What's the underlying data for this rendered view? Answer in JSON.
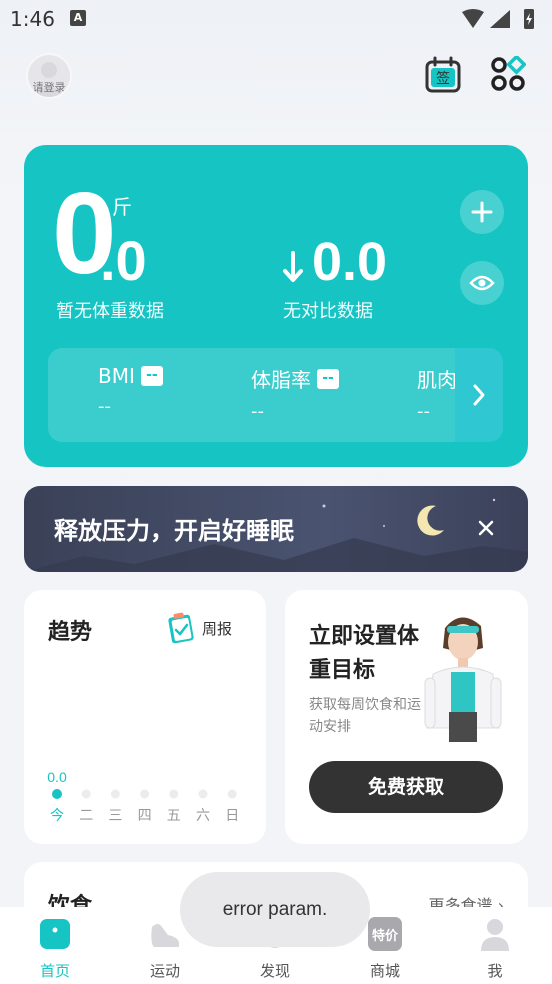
{
  "status_bar": {
    "time": "1:46",
    "notification_letter": "A"
  },
  "header": {
    "avatar_label": "请登录",
    "sign_in_badge": "签"
  },
  "weight_card": {
    "weight_integer": "0",
    "weight_decimal": ".0",
    "unit": "斤",
    "no_weight_text": "暂无体重数据",
    "compare_value": "0.0",
    "no_compare_text": "无对比数据",
    "metrics": [
      {
        "label": "BMI",
        "badge": "--",
        "value": "--"
      },
      {
        "label": "体脂率",
        "badge": "--",
        "value": "--"
      },
      {
        "label": "肌肉",
        "value": "--"
      }
    ],
    "accent_color": "#16c4c4"
  },
  "sleep_banner": {
    "text": "释放压力，开启好睡眠"
  },
  "trend_card": {
    "title": "趋势",
    "report_label": "周报",
    "chart_data": {
      "type": "line",
      "categories": [
        "今",
        "二",
        "三",
        "四",
        "五",
        "六",
        "日"
      ],
      "values": [
        0.0
      ],
      "data_label": "0.0"
    }
  },
  "goal_card": {
    "title": "立即设置体重目标",
    "subtitle": "获取每周饮食和运动安排",
    "button_label": "免费获取"
  },
  "diet_card": {
    "title": "饮食",
    "more_label": "更多食谱"
  },
  "toast": {
    "text": "error param."
  },
  "bottom_nav": [
    {
      "label": "首页",
      "icon": "home-icon",
      "active": true
    },
    {
      "label": "运动",
      "icon": "shoe-icon",
      "active": false
    },
    {
      "label": "发现",
      "icon": "discover-icon",
      "active": false
    },
    {
      "label": "商城",
      "icon": "mall-icon",
      "badge": "特价",
      "active": false
    },
    {
      "label": "我",
      "icon": "profile-icon",
      "active": false
    }
  ]
}
